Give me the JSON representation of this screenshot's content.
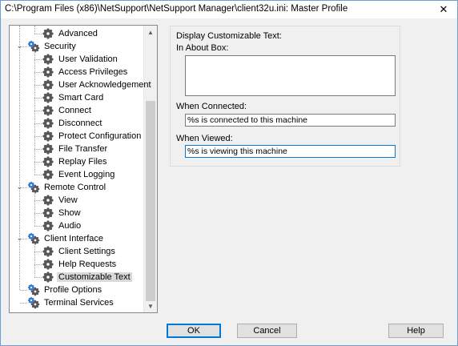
{
  "window": {
    "title": "C:\\Program Files (x86)\\NetSupport\\NetSupport Manager\\client32u.ini: Master Profile",
    "close_glyph": "✕"
  },
  "tree": {
    "items": [
      {
        "label": "Advanced",
        "level": 2,
        "icon": "gear-icon"
      },
      {
        "label": "Security",
        "level": 1,
        "icon": "gears-icon",
        "expander": "collapse"
      },
      {
        "label": "User Validation",
        "level": 2,
        "icon": "gear-icon"
      },
      {
        "label": "Access Privileges",
        "level": 2,
        "icon": "gear-icon"
      },
      {
        "label": "User Acknowledgement",
        "level": 2,
        "icon": "gear-icon"
      },
      {
        "label": "Smart Card",
        "level": 2,
        "icon": "gear-icon"
      },
      {
        "label": "Connect",
        "level": 2,
        "icon": "gear-icon"
      },
      {
        "label": "Disconnect",
        "level": 2,
        "icon": "gear-icon"
      },
      {
        "label": "Protect Configuration",
        "level": 2,
        "icon": "gear-icon"
      },
      {
        "label": "File Transfer",
        "level": 2,
        "icon": "gear-icon"
      },
      {
        "label": "Replay Files",
        "level": 2,
        "icon": "gear-icon"
      },
      {
        "label": "Event Logging",
        "level": 2,
        "icon": "gear-icon"
      },
      {
        "label": "Remote Control",
        "level": 1,
        "icon": "gears-icon",
        "expander": "collapse"
      },
      {
        "label": "View",
        "level": 2,
        "icon": "gear-icon"
      },
      {
        "label": "Show",
        "level": 2,
        "icon": "gear-icon"
      },
      {
        "label": "Audio",
        "level": 2,
        "icon": "gear-icon"
      },
      {
        "label": "Client Interface",
        "level": 1,
        "icon": "gears-icon",
        "expander": "collapse"
      },
      {
        "label": "Client Settings",
        "level": 2,
        "icon": "gear-icon"
      },
      {
        "label": "Help Requests",
        "level": 2,
        "icon": "gear-icon"
      },
      {
        "label": "Customizable Text",
        "level": 2,
        "icon": "gear-icon",
        "selected": true
      },
      {
        "label": "Profile Options",
        "level": 1,
        "icon": "gears-icon"
      },
      {
        "label": "Terminal Services",
        "level": 1,
        "icon": "gears-icon"
      }
    ]
  },
  "panel": {
    "group_label": "Display Customizable Text:",
    "about_label": "In About Box:",
    "about_value": "",
    "connected_label": "When Connected:",
    "connected_value": "%s is connected to this machine",
    "viewed_label": "When Viewed:",
    "viewed_value": "%s is viewing this machine"
  },
  "buttons": {
    "ok": "OK",
    "cancel": "Cancel",
    "help": "Help"
  }
}
